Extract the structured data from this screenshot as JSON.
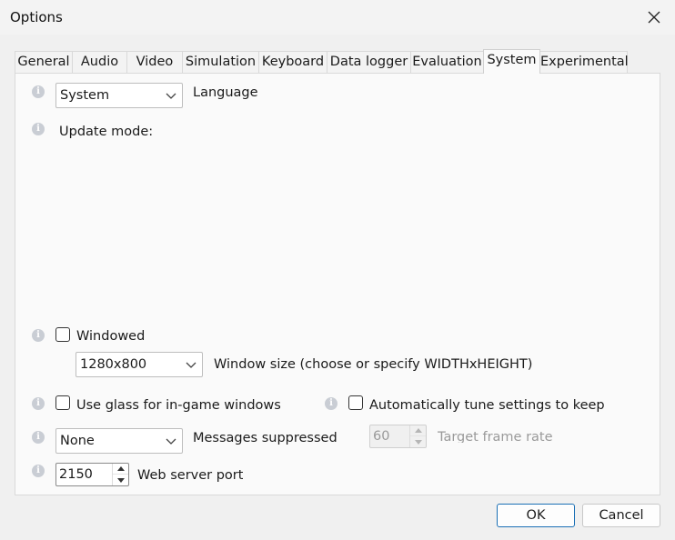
{
  "window": {
    "title": "Options"
  },
  "tabs": [
    "General",
    "Audio",
    "Video",
    "Simulation",
    "Keyboard",
    "Data logger",
    "Evaluation",
    "System",
    "Experimental"
  ],
  "active_tab": "System",
  "language": {
    "value": "System",
    "label": "Language"
  },
  "update_mode": {
    "label": "Update mode:"
  },
  "windowed": {
    "label": "Windowed",
    "checked": false
  },
  "window_size": {
    "value": "1280x800",
    "label": "Window size (choose or specify WIDTHxHEIGHT)"
  },
  "glass": {
    "label": "Use glass for in-game windows",
    "checked": false
  },
  "auto_tune": {
    "label": "Automatically tune settings to keep",
    "checked": false
  },
  "messages": {
    "value": "None",
    "label": "Messages suppressed"
  },
  "frame_rate": {
    "value": "60",
    "label": "Target frame rate"
  },
  "web_port": {
    "value": "2150",
    "label": "Web server port"
  },
  "buttons": {
    "ok": "OK",
    "cancel": "Cancel"
  },
  "info_icon_glyph": "i",
  "colors": {
    "accent": "#1a6fb5",
    "info_icon": "#c9cdd4",
    "panel": "#fafafa"
  }
}
